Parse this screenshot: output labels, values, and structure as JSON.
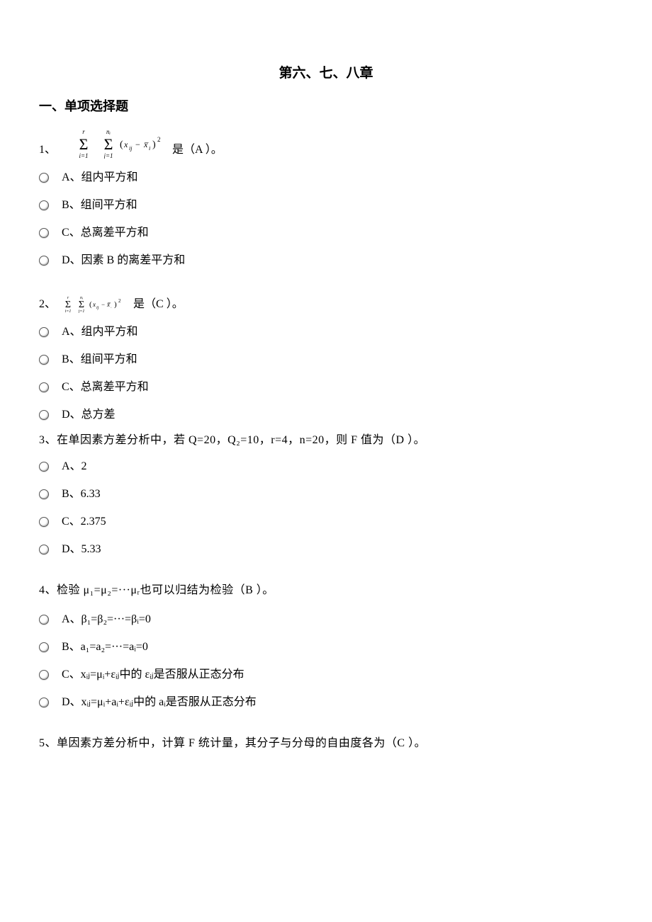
{
  "title": "第六、七、八章",
  "section_heading": "一、单项选择题",
  "q1": {
    "num": "1、",
    "trail": " 是（A ）。",
    "options": {
      "A": "A、组内平方和",
      "B": "B、组间平方和",
      "C": "C、总离差平方和",
      "D": "D、因素 B 的离差平方和"
    }
  },
  "q2": {
    "num": "2、",
    "trail": " 是（C ）。",
    "options": {
      "A": "A、组内平方和",
      "B": "B、组间平方和",
      "C": "C、总离差平方和",
      "D": "D、总方差"
    }
  },
  "q3": {
    "text": "3、在单因素方差分析中，若 Q=20，Q₂=10，r=4，n=20，则 F 值为（D ）。",
    "options": {
      "A": "A、2",
      "B": "B、6.33",
      "C": "C、2.375",
      "D": "D、5.33"
    }
  },
  "q4": {
    "text": "4、检验 μ₁=μ₂=···μᵣ也可以归结为检验（B ）。",
    "options": {
      "A": "A、β₁=β₂=···=βᵢ=0",
      "B": "B、a₁=a₂=···=aᵢ=0",
      "C": "C、xᵢⱼ=μᵢ+εᵢⱼ中的 εᵢⱼ是否服从正态分布",
      "D": "D、xᵢⱼ=μᵢ+aᵢ+εᵢⱼ中的 aᵢ是否服从正态分布"
    }
  },
  "q5": {
    "text": "5、单因素方差分析中，计算 F 统计量，其分子与分母的自由度各为（C ）。"
  }
}
